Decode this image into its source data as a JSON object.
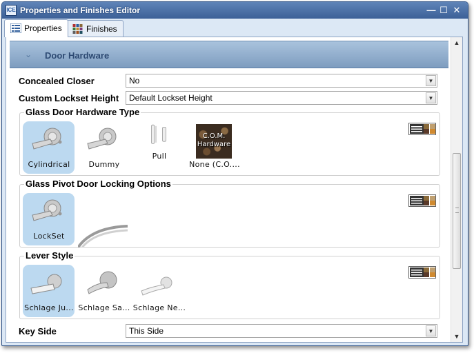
{
  "window": {
    "title": "Properties and Finishes Editor",
    "app_icon_text": "ICE",
    "controls": {
      "minimize": "—",
      "maximize": "☐",
      "close": "✕"
    }
  },
  "tabs": [
    {
      "label": "Properties",
      "icon": "list-icon",
      "active": true
    },
    {
      "label": "Finishes",
      "icon": "color-grid-icon",
      "active": false
    }
  ],
  "section": {
    "title": "Door Hardware",
    "chevron": "⌄"
  },
  "properties": {
    "concealed_closer": {
      "label": "Concealed Closer",
      "value": "No"
    },
    "custom_lockset_height": {
      "label": "Custom Lockset Height",
      "value": "Default Lockset Height"
    },
    "key_side": {
      "label": "Key Side",
      "value": "This Side"
    }
  },
  "groups": {
    "glass_door_hardware_type": {
      "title": "Glass Door Hardware Type",
      "options": [
        {
          "caption": "Cylindrical",
          "selected": true
        },
        {
          "caption": "Dummy",
          "selected": false
        },
        {
          "caption": "Pull",
          "selected": false
        },
        {
          "caption": "None (C.O....",
          "thumb_text": "C.O.M. Hardware",
          "selected": false
        }
      ]
    },
    "glass_pivot_locking": {
      "title": "Glass Pivot Door Locking Options",
      "options": [
        {
          "caption": "LockSet",
          "selected": true
        }
      ]
    },
    "lever_style": {
      "title": "Lever Style",
      "options": [
        {
          "caption": "Schlage Ju...",
          "selected": true
        },
        {
          "caption": "Schlage Sa...",
          "selected": false
        },
        {
          "caption": "Schlage Ne...",
          "selected": false
        }
      ]
    }
  },
  "colors": {
    "titlebar": "#3c6097",
    "section_header": "#8fabcb",
    "selected_option": "#bcd9f0"
  }
}
